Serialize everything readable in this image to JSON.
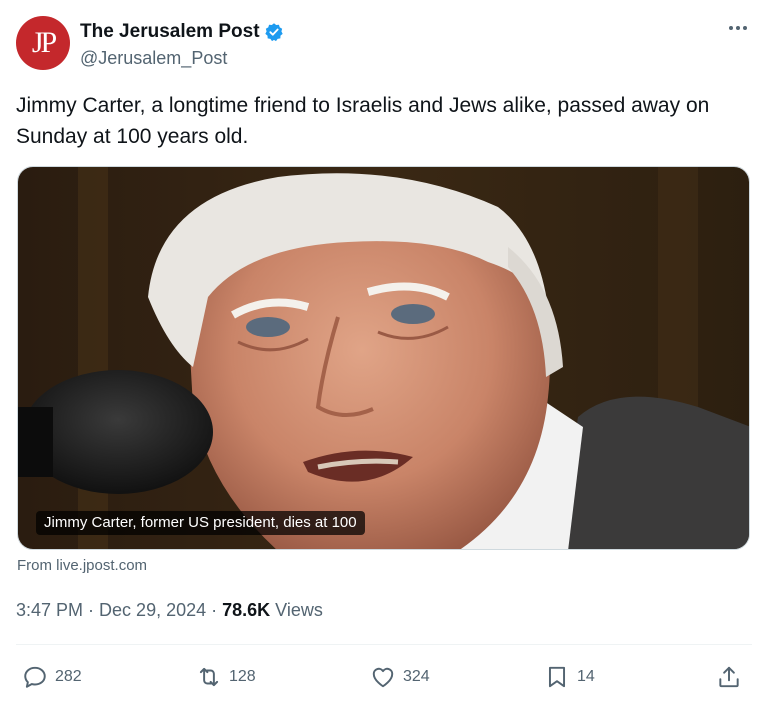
{
  "account": {
    "avatar_text": "JP",
    "display_name": "The Jerusalem Post",
    "handle": "@Jerusalem_Post",
    "verified": true
  },
  "tweet": {
    "text": "Jimmy Carter, a longtime friend to Israelis and Jews alike, passed away on Sunday at 100 years old.",
    "card_caption": "Jimmy Carter, former US president, dies at 100",
    "source": "From live.jpost.com",
    "time": "3:47 PM",
    "separator": "·",
    "date": "Dec 29, 2024",
    "views_count": "78.6K",
    "views_label": "Views"
  },
  "actions": {
    "replies": "282",
    "reposts": "128",
    "likes": "324",
    "bookmarks": "14"
  },
  "icons": {
    "more": "more-icon",
    "verified": "verified-badge-icon",
    "reply": "reply-icon",
    "repost": "repost-icon",
    "like": "heart-icon",
    "bookmark": "bookmark-icon",
    "share": "share-icon"
  },
  "colors": {
    "brand_red": "#c4282c",
    "verified_blue": "#1d9bf0",
    "text": "#0f1419",
    "muted": "#536471"
  }
}
